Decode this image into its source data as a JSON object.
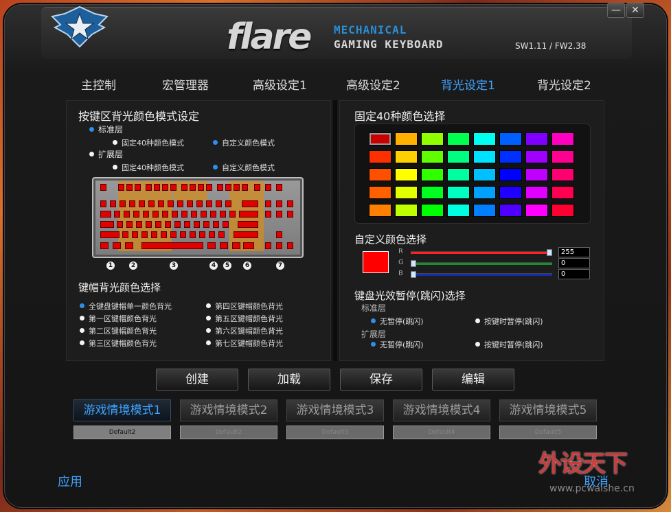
{
  "header": {
    "brand": "flare",
    "tag_top": "MECHANICAL",
    "tag_bottom": "GAMING KEYBOARD",
    "version": "SW1.11 / FW2.38",
    "minimize": "—",
    "close": "✕"
  },
  "tabs": [
    {
      "label": "主控制"
    },
    {
      "label": "宏管理器"
    },
    {
      "label": "高级设定1"
    },
    {
      "label": "高级设定2"
    },
    {
      "label": "背光设定1",
      "active": true
    },
    {
      "label": "背光设定2"
    }
  ],
  "left": {
    "title": "按键区背光颜色模式设定",
    "standard": "标准层",
    "extended": "扩展层",
    "fixed40": "固定40种颜色模式",
    "custom": "自定义颜色模式",
    "zones": [
      "1",
      "2",
      "3",
      "4",
      "5",
      "6",
      "7"
    ],
    "keycap_title": "键帽背光颜色选择",
    "keycap_opts": [
      "全键盘键帽单一颜色背光",
      "第一区键帽颜色背光",
      "第二区键帽颜色背光",
      "第三区键帽颜色背光",
      "第四区键帽颜色背光",
      "第五区键帽颜色背光",
      "第六区键帽颜色背光",
      "第七区键帽颜色背光"
    ]
  },
  "right": {
    "palette_title": "固定40种颜色选择",
    "palette": [
      [
        "#c80000",
        "#ffb000",
        "#90ff00",
        "#00ff50",
        "#00fff0",
        "#0060ff",
        "#8000ff",
        "#ff00c0"
      ],
      [
        "#ff3000",
        "#ffd000",
        "#60ff00",
        "#00ff80",
        "#00e0ff",
        "#0030ff",
        "#a000ff",
        "#ff0090"
      ],
      [
        "#ff5000",
        "#ffff00",
        "#30ff00",
        "#00ffa0",
        "#00c0ff",
        "#0000ff",
        "#c000ff",
        "#ff0070"
      ],
      [
        "#ff6000",
        "#e0ff00",
        "#00ff20",
        "#00ffc0",
        "#00a0ff",
        "#2000ff",
        "#e000ff",
        "#ff0050"
      ],
      [
        "#ff8000",
        "#c0ff00",
        "#00ff00",
        "#00ffe0",
        "#0080ff",
        "#5000ff",
        "#ff00ff",
        "#ff0030"
      ]
    ],
    "custom_title": "自定义颜色选择",
    "r_label": "R",
    "g_label": "G",
    "b_label": "B",
    "r": "255",
    "g": "0",
    "b": "0",
    "r_level": 1.0,
    "g_level": 0.0,
    "b_level": 0.0,
    "preview_color": "#ff0000",
    "pause_title": "键盘光效暂停(跳闪)选择",
    "standard": "标准层",
    "extended": "扩展层",
    "no_pause": "无暂停(跳闪)",
    "pause_on_key": "按键时暂停(跳闪)"
  },
  "actions": {
    "create": "创建",
    "load": "加载",
    "save": "保存",
    "edit": "编辑"
  },
  "modes": [
    {
      "label": "游戏情境模式1",
      "slot": "Default2",
      "active": true
    },
    {
      "label": "游戏情境模式2",
      "slot": "Default2"
    },
    {
      "label": "游戏情境模式3",
      "slot": "Default3"
    },
    {
      "label": "游戏情境模式4",
      "slot": "Default4"
    },
    {
      "label": "游戏情境模式5",
      "slot": "Default5"
    }
  ],
  "footer": {
    "apply": "应用",
    "cancel": "取消"
  },
  "watermark": {
    "main": "外设天下",
    "url": "www.pcwaishe.cn"
  }
}
